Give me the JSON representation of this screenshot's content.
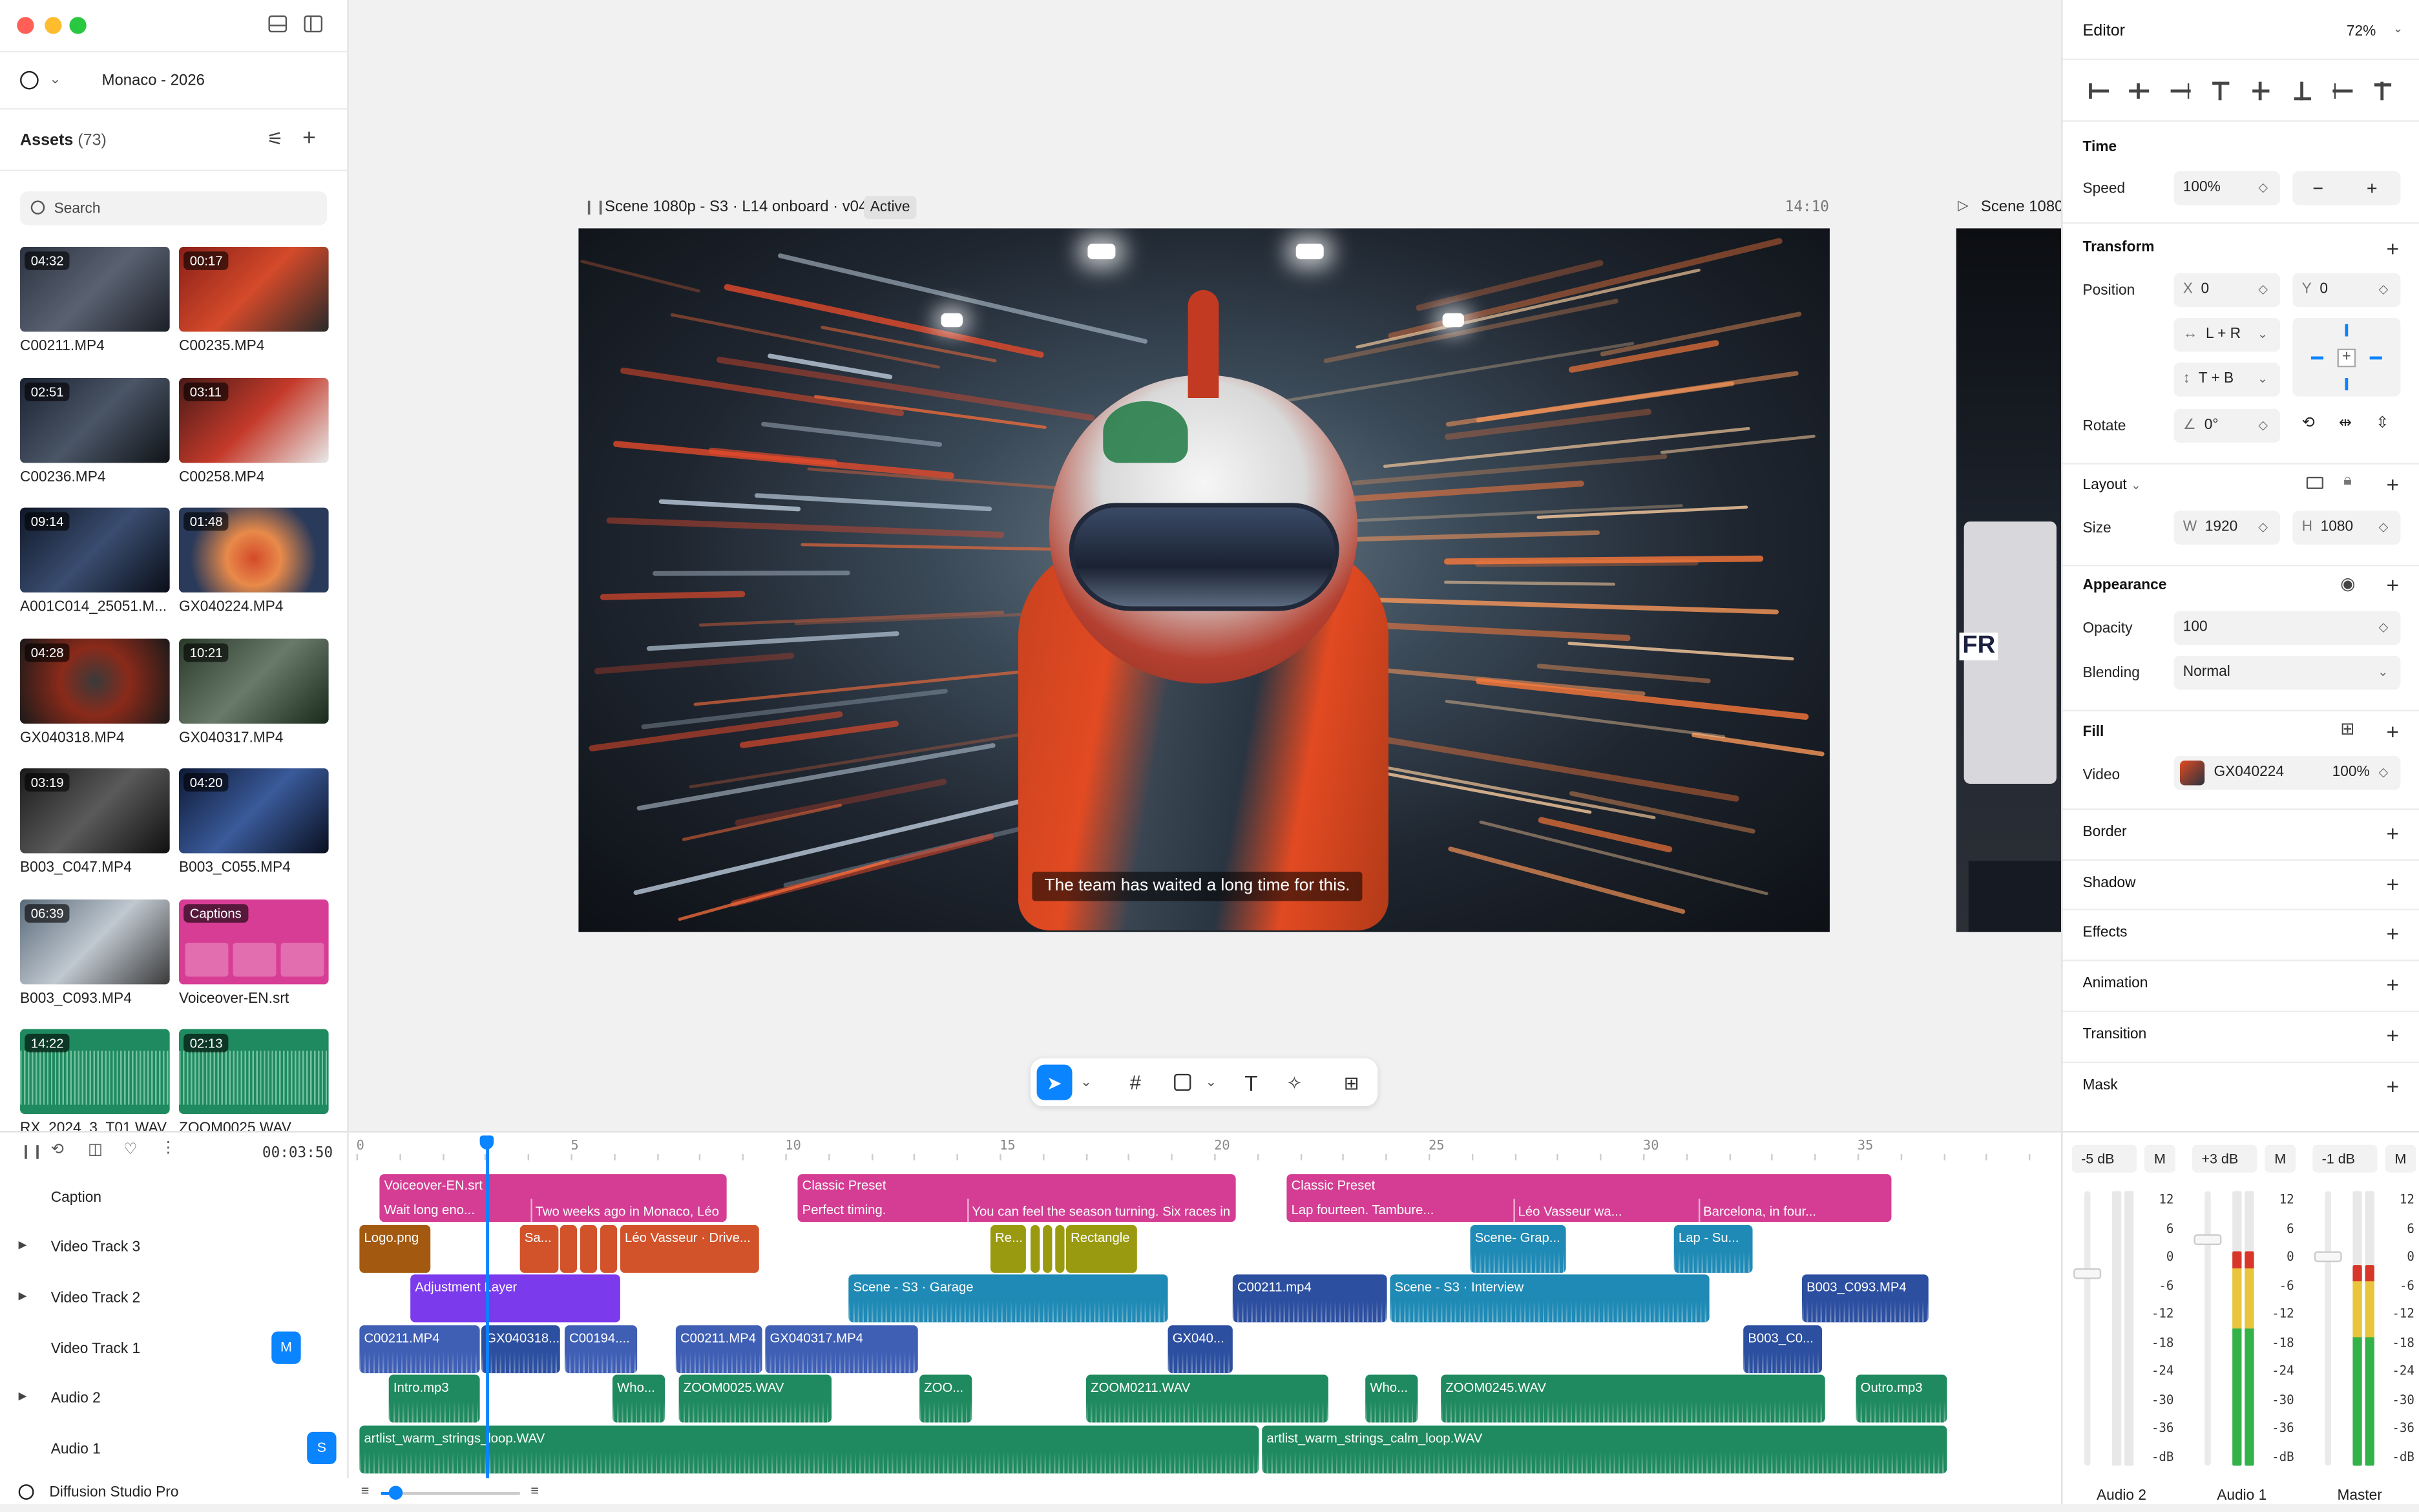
{
  "app": {
    "name": "Diffusion Studio Pro",
    "project": "Monaco - 2026"
  },
  "colors": {
    "accent": "#0a84ff",
    "caption_clip": "#d43d93",
    "audio_clip": "#1f8a5f",
    "video_clip": "#3f5fb5",
    "adjustment": "#7c3aed",
    "dot_red": "#ff5f57",
    "dot_yellow": "#febc2e",
    "dot_green": "#28c840"
  },
  "assets": {
    "title": "Assets",
    "count": "(73)",
    "search_placeholder": "Search",
    "items": [
      {
        "name": "C00211.MP4",
        "duration": "04:32"
      },
      {
        "name": "C00235.MP4",
        "duration": "00:17"
      },
      {
        "name": "C00236.MP4",
        "duration": "02:51"
      },
      {
        "name": "C00258.MP4",
        "duration": "03:11"
      },
      {
        "name": "A001C014_25051.M...",
        "duration": "09:14"
      },
      {
        "name": "GX040224.MP4",
        "duration": "01:48"
      },
      {
        "name": "GX040318.MP4",
        "duration": "04:28"
      },
      {
        "name": "GX040317.MP4",
        "duration": "10:21"
      },
      {
        "name": "B003_C047.MP4",
        "duration": "03:19"
      },
      {
        "name": "B003_C055.MP4",
        "duration": "04:20"
      },
      {
        "name": "B003_C093.MP4",
        "duration": "06:39"
      },
      {
        "name": "Voiceover-EN.srt",
        "duration": "Captions"
      },
      {
        "name": "RX_2024_3_T01.WAV",
        "duration": "14:22"
      },
      {
        "name": "ZOOM0025.WAV",
        "duration": "02:13"
      }
    ]
  },
  "preview": {
    "scene_title": "Scene 1080p - S3 · L14 onboard · v04",
    "status": "Active",
    "timecode": "14:10",
    "next_scene": "Scene 1080",
    "subtitle": "The team has waited a long time for this.",
    "next_frame_text": "FR"
  },
  "editor": {
    "title": "Editor",
    "zoom": "72%",
    "time": {
      "header": "Time",
      "speed_label": "Speed",
      "speed": "100%"
    },
    "transform": {
      "header": "Transform",
      "position_label": "Position",
      "x_label": "X",
      "x": "0",
      "y_label": "Y",
      "y": "0",
      "h_constraint": "L + R",
      "v_constraint": "T + B",
      "rotate_label": "Rotate",
      "rotate": "0°"
    },
    "layout": {
      "header": "Layout",
      "size_label": "Size",
      "w_label": "W",
      "w": "1920",
      "h_label": "H",
      "h": "1080"
    },
    "appearance": {
      "header": "Appearance",
      "opacity_label": "Opacity",
      "opacity": "100",
      "blending_label": "Blending",
      "blending": "Normal"
    },
    "fill": {
      "header": "Fill",
      "video_label": "Video",
      "source": "GX040224",
      "percent": "100%"
    },
    "sections": [
      "Border",
      "Shadow",
      "Effects",
      "Animation",
      "Transition",
      "Mask"
    ]
  },
  "timeline": {
    "timecode": "00:03:50",
    "ruler": [
      "0",
      "5",
      "10",
      "15",
      "20",
      "25",
      "30",
      "35"
    ],
    "tracks": [
      "Caption",
      "Video Track 3",
      "Video Track 2",
      "Video Track 1",
      "Audio 2",
      "Audio 1"
    ],
    "badges": {
      "video1": "M",
      "audio1": "S"
    },
    "clips": {
      "caption": [
        {
          "top": "Voiceover-EN.srt",
          "bottom": "Wait long eno..."
        },
        {
          "bottom": "Two weeks ago in Monaco, Léo"
        },
        {
          "top": "Classic Preset",
          "bottom": "Perfect timing."
        },
        {
          "bottom": "You can feel the season turning. Six races in"
        },
        {
          "top": "Classic Preset",
          "bottom": "Lap fourteen. Tambure..."
        },
        {
          "bottom": "Léo Vasseur wa..."
        },
        {
          "bottom": "Barcelona, in four..."
        }
      ],
      "v3": [
        "Logo.png",
        "Sa...",
        "Léo Vasseur · Drive...",
        "Re...",
        "Rectangle",
        "Scene- Grap...",
        "Lap - Su..."
      ],
      "v2": [
        "Adjustment Layer",
        "Scene - S3 · Garage",
        "C00211.mp4",
        "Scene - S3 · Interview",
        "B003_C093.MP4"
      ],
      "v1": [
        "C00211.MP4",
        "GX040318...",
        "C00194....",
        "C00211.MP4",
        "GX040317.MP4",
        "GX040...",
        "B003_C0..."
      ],
      "a2": [
        "Intro.mp3",
        "Who...",
        "ZOOM0025.WAV",
        "ZOO...",
        "ZOOM0211.WAV",
        "Who...",
        "ZOOM0245.WAV",
        "Outro.mp3"
      ],
      "a1": [
        "artlist_warm_strings_loop.WAV",
        "artlist_warm_strings_calm_loop.WAV"
      ]
    }
  },
  "mixer": {
    "channels": [
      {
        "db": "-5 dB",
        "mute": "M",
        "name": "Audio 2",
        "level": 0
      },
      {
        "db": "+3 dB",
        "mute": "M",
        "name": "Audio 1",
        "level": 0.78
      },
      {
        "db": "-1 dB",
        "mute": "M",
        "name": "Master",
        "level": 0.73
      }
    ],
    "scale": [
      "12",
      "6",
      "0",
      "-6",
      "-12",
      "-18",
      "-24",
      "-30",
      "-36",
      "-dB"
    ]
  }
}
